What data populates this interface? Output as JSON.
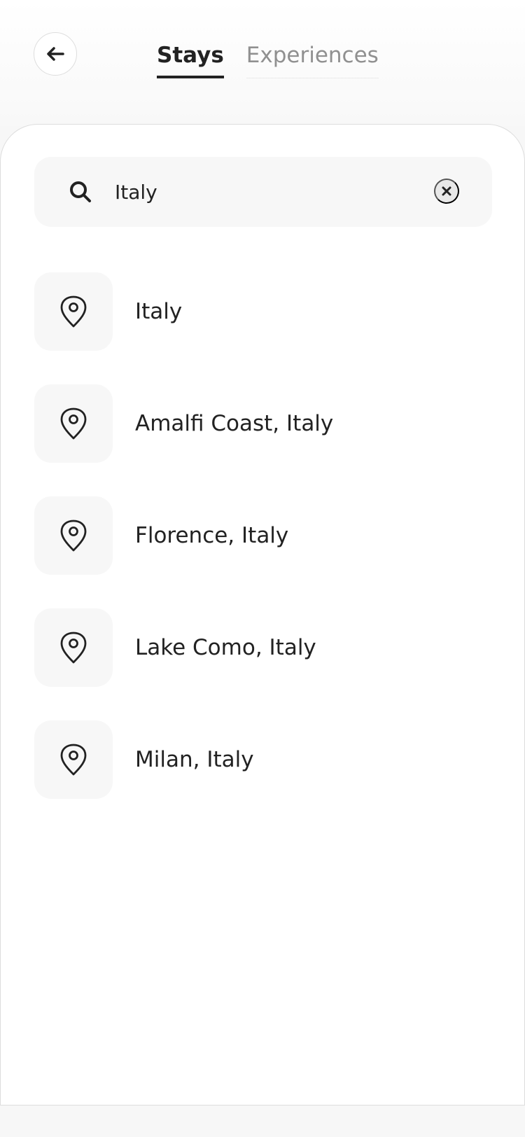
{
  "header": {
    "back_icon": "arrow-left-icon",
    "tabs": [
      {
        "label": "Stays",
        "active": true
      },
      {
        "label": "Experiences",
        "active": false
      }
    ]
  },
  "search": {
    "icon": "search-icon",
    "value": "Italy",
    "clear_icon": "close-icon"
  },
  "results": [
    {
      "label": "Italy",
      "icon": "location-pin-icon"
    },
    {
      "label": "Amalfi Coast, Italy",
      "icon": "location-pin-icon"
    },
    {
      "label": "Florence, Italy",
      "icon": "location-pin-icon"
    },
    {
      "label": "Lake Como, Italy",
      "icon": "location-pin-icon"
    },
    {
      "label": "Milan, Italy",
      "icon": "location-pin-icon"
    }
  ],
  "colors": {
    "text": "#222222",
    "muted": "#909090",
    "surface": "#f7f7f7",
    "border": "#dddddd"
  }
}
